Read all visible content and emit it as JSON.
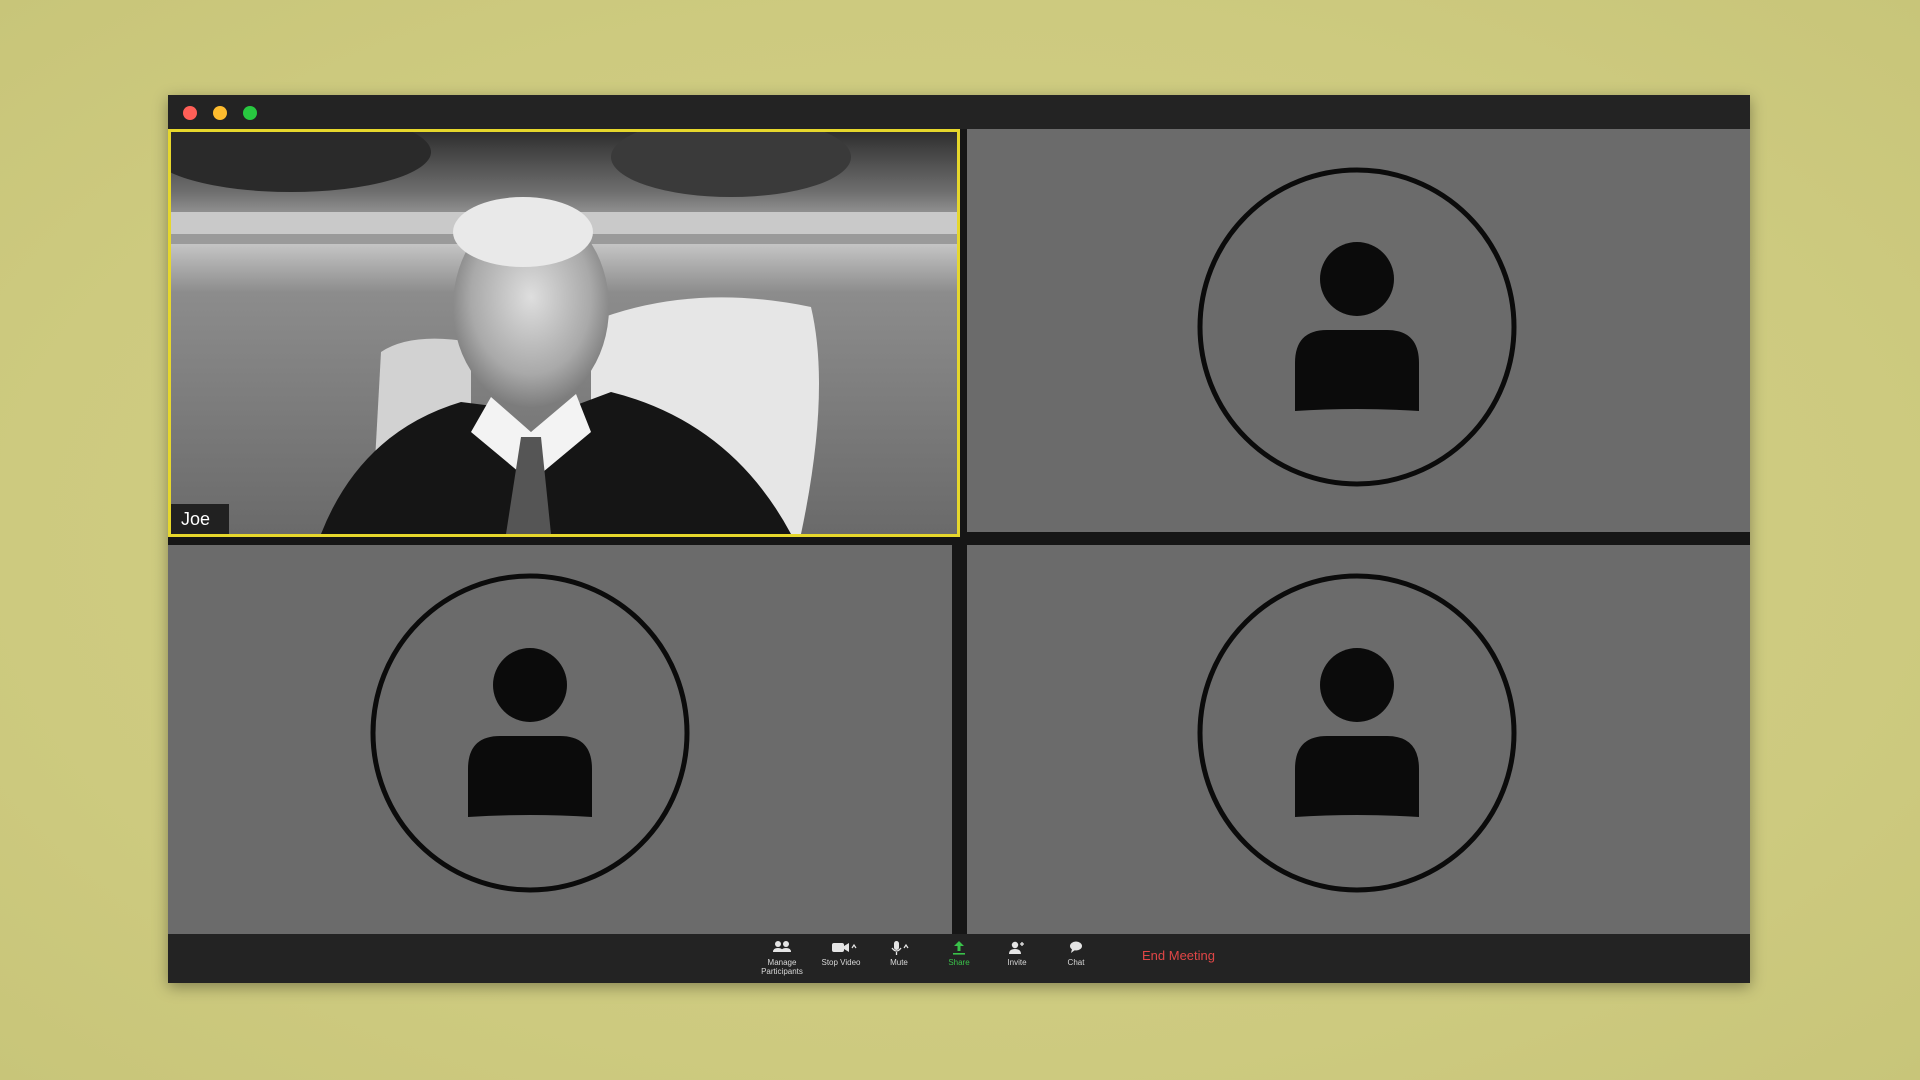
{
  "window": {
    "controls": [
      {
        "name": "close",
        "color": "#ff5f57"
      },
      {
        "name": "minimize",
        "color": "#febc2e"
      },
      {
        "name": "maximize",
        "color": "#28c840"
      }
    ]
  },
  "participants": [
    {
      "name": "Joe",
      "video": true,
      "active_speaker": true
    },
    {
      "name": "",
      "video": false,
      "icon": "person-avatar-icon"
    },
    {
      "name": "",
      "video": false,
      "icon": "person-avatar-icon"
    },
    {
      "name": "",
      "video": false,
      "icon": "person-avatar-icon"
    }
  ],
  "toolbar": {
    "manage_participants": "Manage Participants",
    "stop_video": "Stop Video",
    "mute": "Mute",
    "share": "Share",
    "invite": "Invite",
    "chat": "Chat",
    "end_meeting": "End Meeting"
  },
  "colors": {
    "active_speaker_border": "#e6d72c",
    "share": "#3ac24a",
    "end_meeting": "#e04646",
    "tile_background": "#6b6b6b",
    "page_background": "#cfcd82"
  }
}
